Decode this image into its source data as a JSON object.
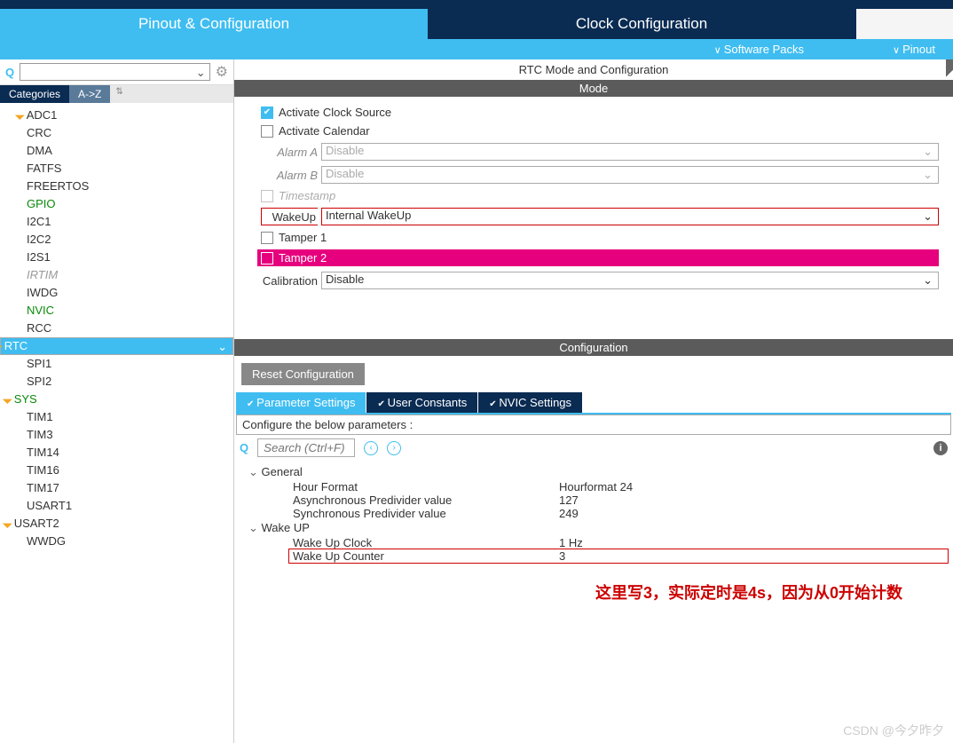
{
  "mainTabs": {
    "pinout": "Pinout & Configuration",
    "clock": "Clock Configuration"
  },
  "subBar": {
    "packs": "Software Packs",
    "pinout": "Pinout"
  },
  "catTabs": {
    "cat": "Categories",
    "az": "A->Z"
  },
  "categories": [
    {
      "label": "ADC1",
      "cls": "warn indent"
    },
    {
      "label": "CRC",
      "cls": "indent"
    },
    {
      "label": "DMA",
      "cls": "indent"
    },
    {
      "label": "FATFS",
      "cls": "indent"
    },
    {
      "label": "FREERTOS",
      "cls": "indent"
    },
    {
      "label": "GPIO",
      "cls": "green indent"
    },
    {
      "label": "I2C1",
      "cls": "indent"
    },
    {
      "label": "I2C2",
      "cls": "indent"
    },
    {
      "label": "I2S1",
      "cls": "indent"
    },
    {
      "label": "IRTIM",
      "cls": "gray indent"
    },
    {
      "label": "IWDG",
      "cls": "indent"
    },
    {
      "label": "NVIC",
      "cls": "green indent"
    },
    {
      "label": "RCC",
      "cls": "indent"
    },
    {
      "label": "RTC",
      "cls": "warn sel"
    },
    {
      "label": "SPI1",
      "cls": "indent"
    },
    {
      "label": "SPI2",
      "cls": "indent"
    },
    {
      "label": "SYS",
      "cls": "warn green"
    },
    {
      "label": "TIM1",
      "cls": "indent"
    },
    {
      "label": "TIM3",
      "cls": "indent"
    },
    {
      "label": "TIM14",
      "cls": "indent"
    },
    {
      "label": "TIM16",
      "cls": "indent"
    },
    {
      "label": "TIM17",
      "cls": "indent"
    },
    {
      "label": "USART1",
      "cls": "indent"
    },
    {
      "label": "USART2",
      "cls": "warn"
    },
    {
      "label": "WWDG",
      "cls": "indent"
    }
  ],
  "panelTitle": "RTC Mode and Configuration",
  "modeHeader": "Mode",
  "mode": {
    "activateClock": "Activate Clock Source",
    "activateCal": "Activate Calendar",
    "alarmA_l": "Alarm A",
    "alarmA_v": "Disable",
    "alarmB_l": "Alarm B",
    "alarmB_v": "Disable",
    "timestamp": "Timestamp",
    "wakeup_l": "WakeUp",
    "wakeup_v": "Internal WakeUp",
    "tamper1": "Tamper 1",
    "tamper2": "Tamper 2",
    "calib_l": "Calibration",
    "calib_v": "Disable"
  },
  "configHeader": "Configuration",
  "resetBtn": "Reset Configuration",
  "cfgTabs": {
    "param": "Parameter Settings",
    "user": "User Constants",
    "nvic": "NVIC Settings"
  },
  "cfgHead": "Configure the below parameters :",
  "searchPh": "Search (Ctrl+F)",
  "params": {
    "general": "General",
    "hourFmt_k": "Hour Format",
    "hourFmt_v": "Hourformat 24",
    "async_k": "Asynchronous Predivider value",
    "async_v": "127",
    "sync_k": "Synchronous Predivider value",
    "sync_v": "249",
    "wakeup": "Wake UP",
    "wuclk_k": "Wake Up Clock",
    "wuclk_v": "1 Hz",
    "wucnt_k": "Wake Up Counter",
    "wucnt_v": "3"
  },
  "annotation": "这里写3，实际定时是4s，因为从0开始计数",
  "watermark": "CSDN @今夕昨夕"
}
